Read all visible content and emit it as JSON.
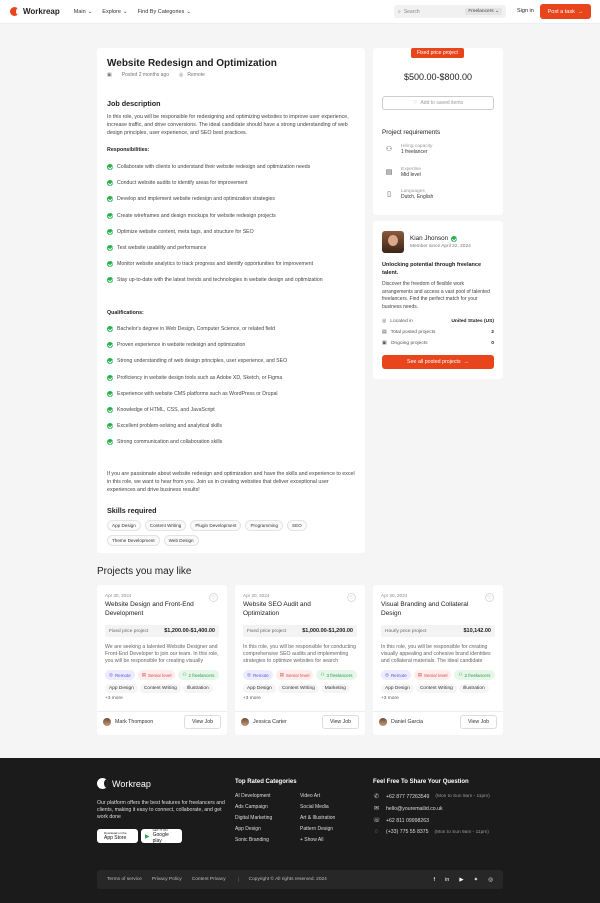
{
  "header": {
    "brand": "Workreap",
    "nav": [
      "Main",
      "Explore",
      "Find By Categories"
    ],
    "search_placeholder": "Search",
    "search_scope": "Freelancers",
    "signin": "Sign in",
    "post_task": "Post a task"
  },
  "job": {
    "title": "Website Redesign and Optimization",
    "posted": "Posted 2 months ago",
    "location": "Remote",
    "desc_heading": "Job description",
    "intro": "In this role, you will be responsible for redesigning and optimizing websites to improve user experience, increase traffic, and drive conversions. The ideal candidate should have a strong understanding of web design principles, user experience, and SEO best practices.",
    "resp_heading": "Responsibilities:",
    "responsibilities": [
      "Collaborate with clients to understand their website redesign and optimization needs",
      "Conduct website audits to identify areas for improvement",
      "Develop and implement website redesign and optimization strategies",
      "Create wireframes and design mockups for website redesign projects",
      "Optimize website content, meta tags, and structure for SEO",
      "Test website usability and performance",
      "Monitor website analytics to track progress and identify opportunities for improvement",
      "Stay up-to-date with the latest trends and technologies in website design and optimization"
    ],
    "qual_heading": "Qualifications:",
    "qualifications": [
      "Bachelor's degree in Web Design, Computer Science, or related field",
      "Proven experience in website redesign and optimization",
      "Strong understanding of web design principles, user experience, and SEO",
      "Proficiency in website design tools such as Adobe XD, Sketch, or Figma",
      "Experience with website CMS platforms such as WordPress or Drupal",
      "Knowledge of HTML, CSS, and JavaScript",
      "Excellent problem-solving and analytical skills",
      "Strong communication and collaboration skills"
    ],
    "closing": "If you are passionate about website redesign and optimization and have the skills and experience to excel in this role, we want to hear from you. Join us in creating websites that deliver exceptional user experiences and drive business results!",
    "skills_heading": "Skills required",
    "skills": [
      "App Design",
      "Content Writing",
      "Plugin Development",
      "Programming",
      "SEO",
      "Theme Development",
      "Web Design"
    ]
  },
  "sidebar": {
    "tag": "Fixed price project",
    "price": "$500.00-$800.00",
    "save": "Add to saved items",
    "req_heading": "Project requirements",
    "requirements": [
      {
        "label": "Hiring capacity",
        "value": "1 freelancer"
      },
      {
        "label": "Expertise",
        "value": "Mid level"
      },
      {
        "label": "Languages",
        "value": "Dutch, English"
      }
    ]
  },
  "client": {
    "name": "Kian Jhonson",
    "since": "Member since April 22, 2024",
    "headline": "Unlocking potential through freelance talent.",
    "about": "Discover the freedom of flexible work arrangements and access a vast pool of talented freelancers. Find the perfect match for your business needs.",
    "rows": [
      {
        "label": "Located in",
        "value": "United States (US)"
      },
      {
        "label": "Total posted projects",
        "value": "2"
      },
      {
        "label": "Ongoing projects",
        "value": "0"
      }
    ],
    "cta": "See all posted projects"
  },
  "related": {
    "heading": "Projects you may like",
    "cards": [
      {
        "date": "Apr 30, 2024",
        "title": "Website Design and Front-End Development",
        "price_type": "Fixed price project",
        "price": "$1,200.00-$1,400.00",
        "desc": "We are seeking a talented Website Designer and Front-End Developer to join our team. In this role, you will be responsible for creating visually appealing",
        "tags": [
          "Remote",
          "Senior level",
          "2 freelancers"
        ],
        "skills": [
          "App Design",
          "Content Writing",
          "Illustration"
        ],
        "more": "+3 more",
        "user": "Mark Thompson",
        "view": "View Job"
      },
      {
        "date": "Apr 30, 2024",
        "title": "Website SEO Audit and Optimization",
        "price_type": "Fixed price project",
        "price": "$1,000.00-$1,200.00",
        "desc": "In this role, you will be responsible for conducting comprehensive SEO audits and implementing strategies to optimize websites for search",
        "tags": [
          "Remote",
          "Senior level",
          "3 freelancers"
        ],
        "skills": [
          "App Design",
          "Content Writing",
          "Marketing"
        ],
        "more": "+3 more",
        "user": "Jessica Carter",
        "view": "View Job"
      },
      {
        "date": "Apr 30, 2024",
        "title": "Visual Branding and Collateral Design",
        "price_type": "Hourly price project",
        "price": "$10,142.00",
        "desc": "In this role, you will be responsible for creating visually appealing and cohesive brand identities and collateral materials. The ideal candidate",
        "tags": [
          "Remote",
          "Senior level",
          "2 freelancers"
        ],
        "skills": [
          "App Design",
          "Content Writing",
          "Illustration"
        ],
        "more": "+3 more",
        "user": "Daniel Garcia",
        "view": "View Job"
      }
    ]
  },
  "footer": {
    "brand": "Workreap",
    "desc": "Our platform offers the best features for freelancers and clients, making it easy to connect, collaborate, and get work done",
    "appstore_small": "Download on the",
    "appstore": "App Store",
    "play_small": "GET IT ON",
    "play": "Google play",
    "cat_heading": "Top Rated Categories",
    "cats_left": [
      "AI Development",
      "Ads Campaign",
      "Digital Marketing",
      "App Design",
      "Sonic Branding"
    ],
    "cats_right": [
      "Video Art",
      "Social Media",
      "Art & Illustration",
      "Pattern Design",
      "+ Show All"
    ],
    "contact_heading": "Feel Free To Share Your Question",
    "contacts": [
      {
        "value": "+62 877 77263549",
        "hours": "(Mon to Sun 9am - 11pm)"
      },
      {
        "value": "hello@youremailid.co.uk",
        "hours": ""
      },
      {
        "value": "+62 811 09998263",
        "hours": ""
      },
      {
        "value": "(+33) 775 55 8375",
        "hours": "(Mon to Sun 9am - 11pm)"
      }
    ],
    "links": [
      "Terms of service",
      "Privacy Policy",
      "Content Privacy"
    ],
    "copyright": "Copyright © All rights reserved. 2024",
    "social": [
      "facebook-icon",
      "linkedin-icon",
      "youtube-icon",
      "twitter-icon",
      "dribbble-icon"
    ]
  }
}
